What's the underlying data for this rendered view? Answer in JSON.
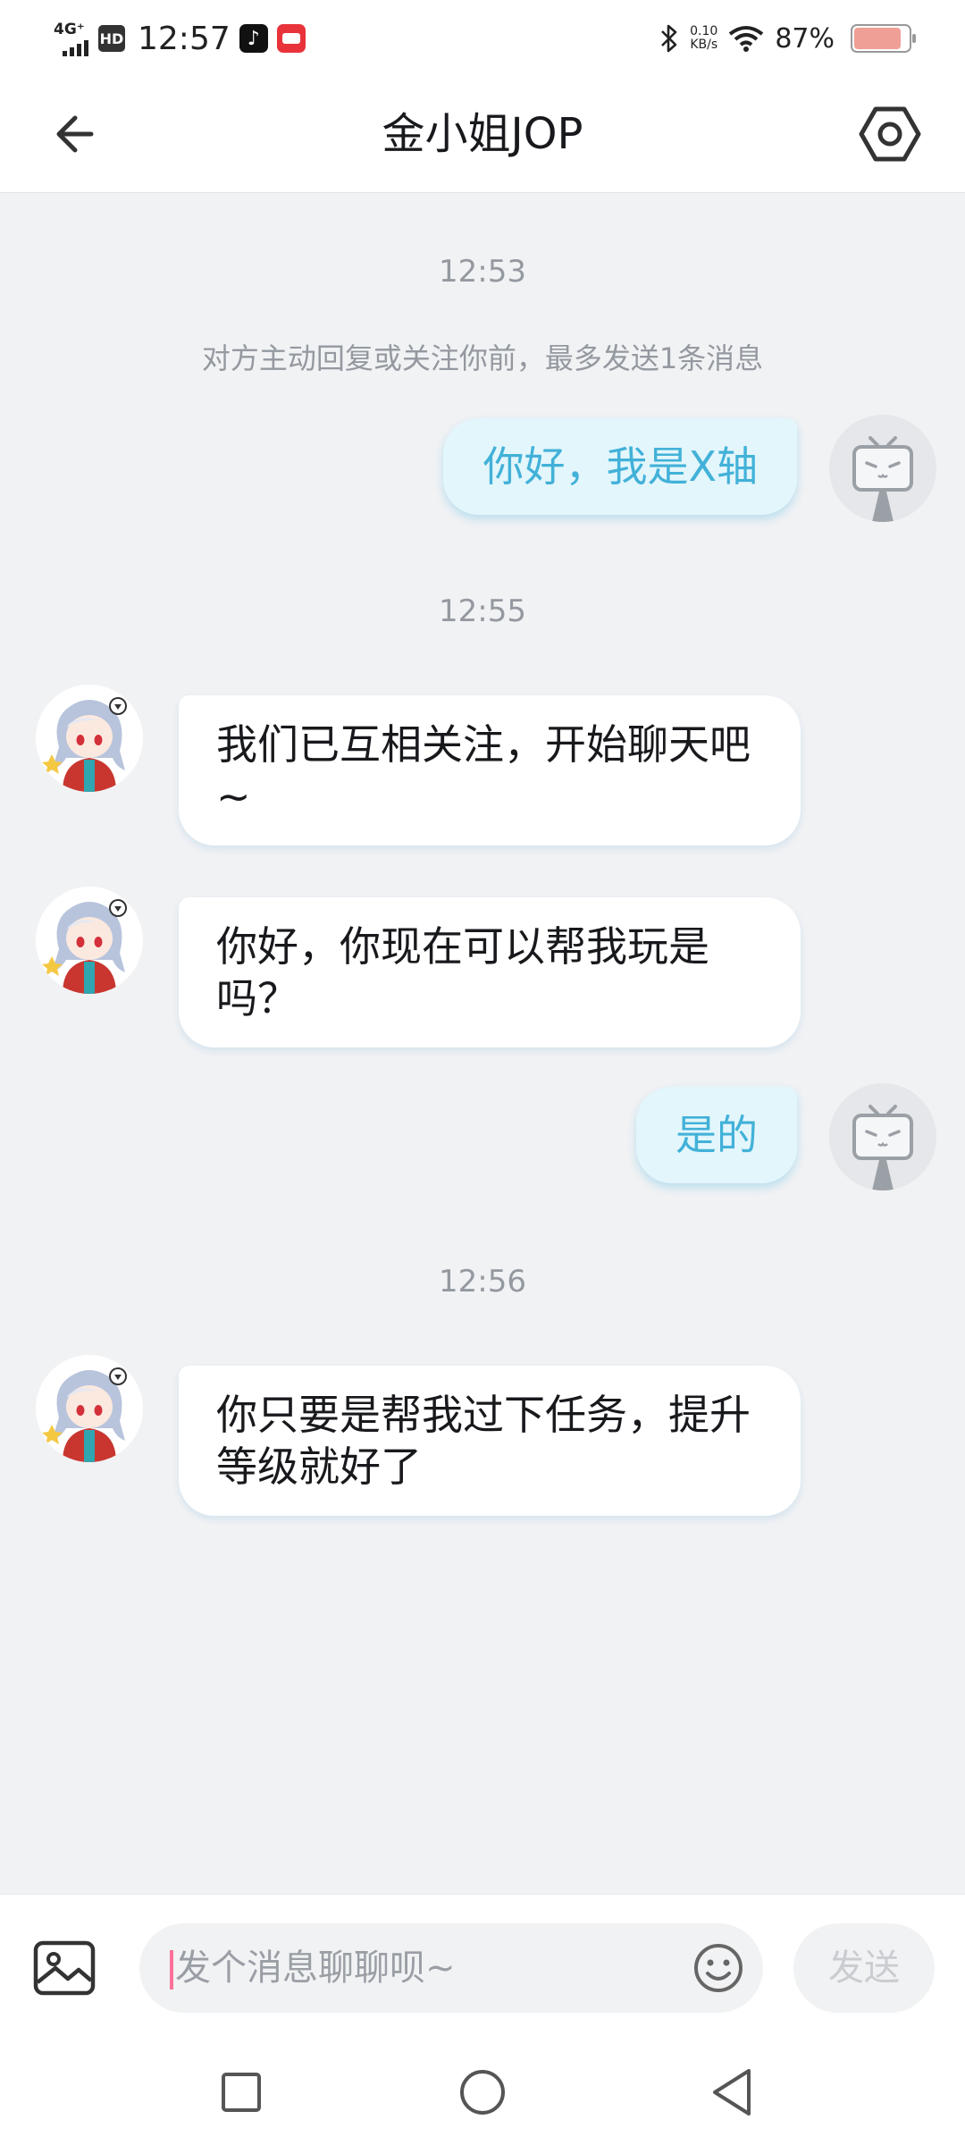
{
  "status_bar": {
    "network": "4G⁺",
    "hd": "HD",
    "time": "12:57",
    "speed_value": "0.10",
    "speed_unit": "KB/s",
    "battery": "87%",
    "battery_level": 0.87,
    "icons": [
      "signal-icon",
      "tiktok-icon",
      "app-icon",
      "bluetooth-icon",
      "wifi-icon",
      "battery-icon"
    ]
  },
  "header": {
    "title": "金小姐JOP",
    "back_icon": "arrow-left-icon",
    "settings_icon": "hexagon-settings-icon"
  },
  "chat": {
    "timestamps": [
      "12:53",
      "12:55",
      "12:56"
    ],
    "notice": "对方主动回复或关注你前，最多发送1条消息",
    "messages": [
      {
        "sender": "me",
        "text": "你好，我是X轴"
      },
      {
        "sender": "other",
        "text": "我们已互相关注，开始聊天吧~"
      },
      {
        "sender": "other",
        "text": "你好，你现在可以帮我玩是吗？"
      },
      {
        "sender": "me",
        "text": "是的"
      },
      {
        "sender": "other",
        "text": "你只要是帮我过下任务，提升等级就好了"
      }
    ]
  },
  "input_bar": {
    "placeholder": "发个消息聊聊呗~",
    "send_label": "发送",
    "image_icon": "image-icon",
    "emoji_icon": "emoji-icon"
  },
  "navbar": {
    "icons": [
      "square-recents-icon",
      "circle-home-icon",
      "triangle-back-icon"
    ]
  },
  "colors": {
    "accent": "#42b1d8",
    "outgoing_bubble": "#e3f6fc",
    "background": "#f1f2f4",
    "caret": "#fb7299",
    "battery_fill": "#ef9f96"
  }
}
